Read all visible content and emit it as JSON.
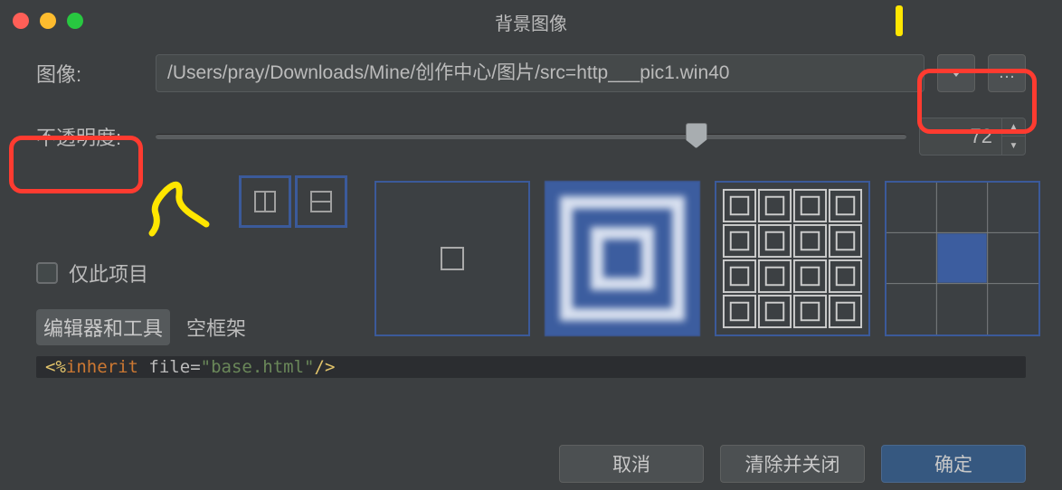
{
  "window": {
    "title": "背景图像"
  },
  "labels": {
    "image": "图像:",
    "opacity": "不透明度:",
    "only_this_project": "仅此项目"
  },
  "image_path": "/Users/pray/Downloads/Mine/创作中心/图片/src=http___pic1.win40",
  "opacity": {
    "value": 72,
    "min": 0,
    "max": 100
  },
  "tabs": {
    "selected": "编辑器和工具",
    "other": "空框架"
  },
  "code_tokens": {
    "open": "<%",
    "kw": "inherit",
    "attr": "file",
    "eq": "=",
    "q1": "\"",
    "str": "base.html",
    "q2": "\"",
    "close": "/>"
  },
  "buttons": {
    "cancel": "取消",
    "clear_close": "清除并关闭",
    "ok": "确定"
  }
}
